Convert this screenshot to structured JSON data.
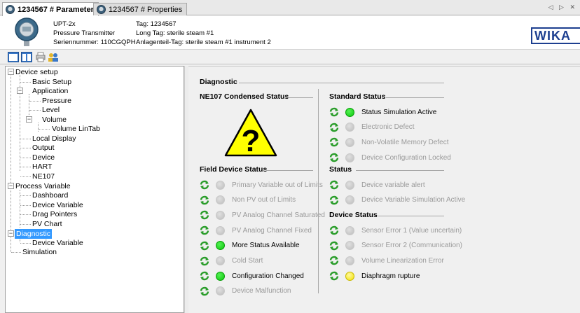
{
  "tabs": [
    {
      "label": "1234567 # Parameter",
      "active": true
    },
    {
      "label": "1234567 # Properties",
      "active": false
    }
  ],
  "tab_nav": "◁ ▷ ✕",
  "header": {
    "device_name": "UPT-2x",
    "device_type": "Pressure Transmitter",
    "serial": "Seriennummer: 110CGQPH",
    "tag": "Tag: 1234567",
    "long_tag": "Long Tag: sterile steam #1",
    "plant_tag": "Anlagenteil-Tag: sterile steam #1 instrument 2",
    "brand": "WIKA"
  },
  "tree": {
    "nodes": [
      {
        "id": "device-setup",
        "label": "Device setup",
        "toggle": "−"
      },
      {
        "id": "basic-setup",
        "label": "Basic Setup"
      },
      {
        "id": "application",
        "label": "Application",
        "toggle": "−"
      },
      {
        "id": "pressure",
        "label": "Pressure"
      },
      {
        "id": "level",
        "label": "Level"
      },
      {
        "id": "volume",
        "label": "Volume",
        "toggle": "−"
      },
      {
        "id": "volume-lintab",
        "label": "Volume LinTab"
      },
      {
        "id": "local-display",
        "label": "Local Display"
      },
      {
        "id": "output",
        "label": "Output"
      },
      {
        "id": "device",
        "label": "Device"
      },
      {
        "id": "hart",
        "label": "HART"
      },
      {
        "id": "ne107",
        "label": "NE107"
      },
      {
        "id": "process-variable",
        "label": "Process Variable",
        "toggle": "−"
      },
      {
        "id": "dashboard",
        "label": "Dashboard"
      },
      {
        "id": "device-variable-pv",
        "label": "Device Variable"
      },
      {
        "id": "drag-pointers",
        "label": "Drag Pointers"
      },
      {
        "id": "pv-chart",
        "label": "PV Chart"
      },
      {
        "id": "diagnostic",
        "label": "Diagnostic",
        "toggle": "−",
        "selected": true
      },
      {
        "id": "device-variable-diag",
        "label": "Device Variable"
      },
      {
        "id": "simulation",
        "label": "Simulation"
      }
    ]
  },
  "content": {
    "title": "Diagnostic",
    "ne107_title": "NE107 Condensed Status",
    "ne107_symbol": "?",
    "field_title": "Field Device Status",
    "field_items": [
      {
        "label": "Primary Variable out of Limits",
        "state": "grey"
      },
      {
        "label": "Non PV out of Limits",
        "state": "grey"
      },
      {
        "label": "PV Analog Channel Saturated",
        "state": "grey"
      },
      {
        "label": "PV Analog Channel Fixed",
        "state": "grey"
      },
      {
        "label": "More Status Available",
        "state": "green"
      },
      {
        "label": "Cold Start",
        "state": "grey"
      },
      {
        "label": "Configuration Changed",
        "state": "green"
      },
      {
        "label": "Device Malfunction",
        "state": "grey"
      }
    ],
    "standard_title": "Standard Status",
    "standard_items": [
      {
        "label": "Status Simulation Active",
        "state": "green"
      },
      {
        "label": "Electronic Defect",
        "state": "grey"
      },
      {
        "label": "Non-Volatile Memory Defect",
        "state": "grey"
      },
      {
        "label": "Device Configuration Locked",
        "state": "grey"
      }
    ],
    "status_title": "Status",
    "status_items": [
      {
        "label": "Device variable alert",
        "state": "grey"
      },
      {
        "label": "Device Variable Simulation Active",
        "state": "grey"
      }
    ],
    "device_status_title": "Device Status",
    "device_status_items": [
      {
        "label": "Sensor Error 1 (Value uncertain)",
        "state": "grey"
      },
      {
        "label": "Sensor Error 2 (Communication)",
        "state": "grey"
      },
      {
        "label": "Volume Linearization Error",
        "state": "grey"
      },
      {
        "label": "Diaphragm rupture",
        "state": "yellow"
      }
    ]
  },
  "colors": {
    "selection": "#3399ff",
    "green": "#0bc80b",
    "yellow": "#f2e200",
    "grey": "#c4c4c4",
    "brand": "#1d3f90"
  }
}
